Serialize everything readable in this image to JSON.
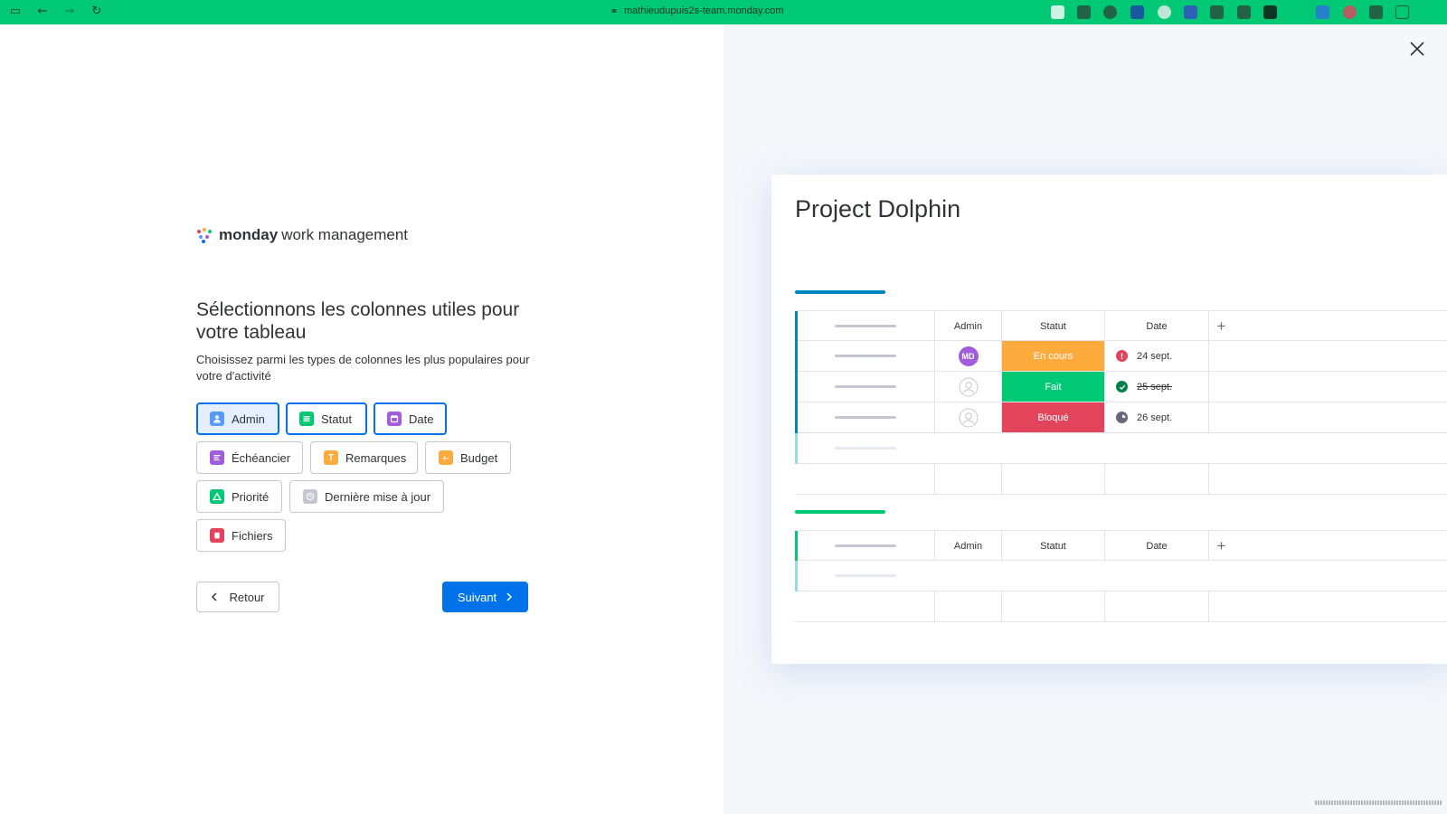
{
  "browser": {
    "url": "mathieudupuis2s-team.monday.com"
  },
  "logo": {
    "brand": "monday",
    "product": "work management"
  },
  "wizard": {
    "title": "Sélectionnons les colonnes utiles pour votre tableau",
    "subtitle": "Choisissez parmi les types de colonnes les plus populaires pour votre d'activité",
    "columns": [
      {
        "label": "Admin",
        "icon": "person-icon",
        "color": "#579bfc",
        "selected": true
      },
      {
        "label": "Statut",
        "icon": "status-icon",
        "color": "#00c875",
        "selected": true
      },
      {
        "label": "Date",
        "icon": "calendar-icon",
        "color": "#a25ddc",
        "selected": true
      },
      {
        "label": "Échéancier",
        "icon": "timeline-icon",
        "color": "#a25ddc",
        "selected": false
      },
      {
        "label": "Remarques",
        "icon": "text-icon",
        "color": "#fdab3d",
        "selected": false
      },
      {
        "label": "Budget",
        "icon": "numbers-icon",
        "color": "#fdab3d",
        "selected": false
      },
      {
        "label": "Priorité",
        "icon": "priority-icon",
        "color": "#00c875",
        "selected": false
      },
      {
        "label": "Dernière mise à jour",
        "icon": "clock-icon",
        "color": "#9699a6",
        "selected": false
      },
      {
        "label": "Fichiers",
        "icon": "files-icon",
        "color": "#e2445c",
        "selected": false
      }
    ],
    "back_label": "Retour",
    "next_label": "Suivant"
  },
  "board": {
    "title": "Project Dolphin",
    "group1_color": "#0086c0",
    "group2_color": "#00c875",
    "headers": [
      "Admin",
      "Statut",
      "Date"
    ],
    "add_column": "+",
    "rows": [
      {
        "avatar": "MD",
        "status": "En cours",
        "status_color": "#fdab3d",
        "date": "24 sept.",
        "date_icon": "alert-icon",
        "date_icon_color": "#e2445c",
        "done": false
      },
      {
        "avatar": "",
        "status": "Fait",
        "status_color": "#00c875",
        "date": "25 sept.",
        "date_icon": "check-icon",
        "date_icon_color": "#037f4c",
        "done": true
      },
      {
        "avatar": "",
        "status": "Bloqué",
        "status_color": "#e2445c",
        "date": "26 sept.",
        "date_icon": "clock-icon",
        "date_icon_color": "#676879",
        "done": false
      }
    ]
  },
  "colors": {
    "accent": "#0073ea",
    "browser_bar": "#00c875"
  }
}
